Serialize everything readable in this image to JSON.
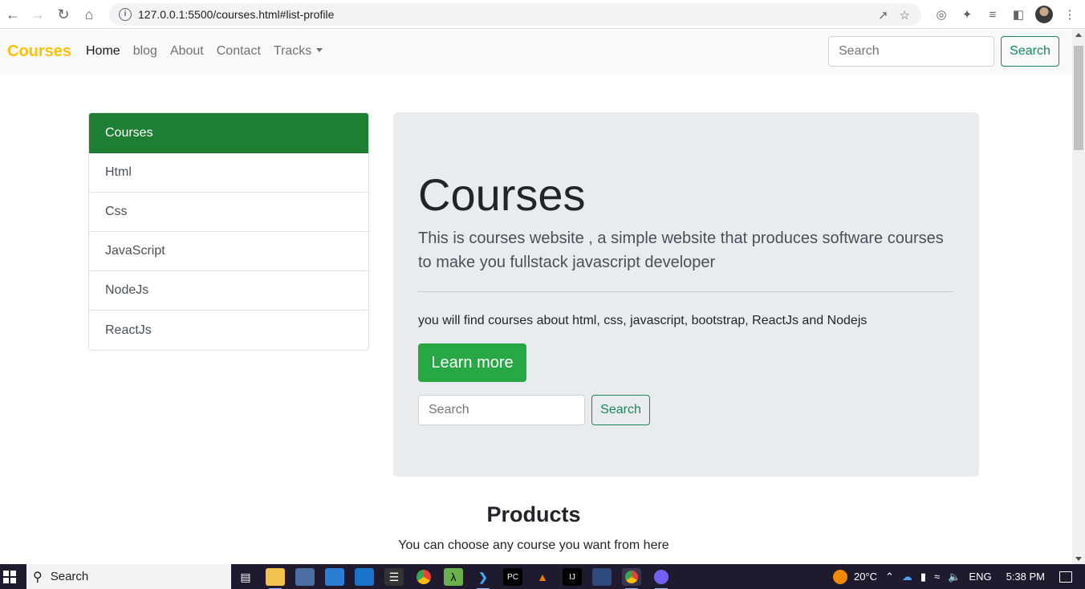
{
  "browser": {
    "url": "127.0.0.1:5500/courses.html#list-profile"
  },
  "navbar": {
    "brand": "Courses",
    "links": [
      {
        "label": "Home",
        "active": true
      },
      {
        "label": "blog",
        "active": false
      },
      {
        "label": "About",
        "active": false
      },
      {
        "label": "Contact",
        "active": false
      },
      {
        "label": "Tracks",
        "active": false,
        "dropdown": true
      }
    ],
    "search_placeholder": "Search",
    "search_button": "Search"
  },
  "list_group": {
    "items": [
      {
        "label": "Courses",
        "active": true
      },
      {
        "label": "Html",
        "active": false
      },
      {
        "label": "Css",
        "active": false
      },
      {
        "label": "JavaScript",
        "active": false
      },
      {
        "label": "NodeJs",
        "active": false
      },
      {
        "label": "ReactJs",
        "active": false
      }
    ]
  },
  "jumbotron": {
    "title": "Courses",
    "lead": "This is courses website , a simple website that produces software courses to make you fullstack javascript developer",
    "text": "you will find courses about html, css, javascript, bootstrap, ReactJs and Nodejs",
    "button": "Learn more",
    "search_placeholder": "Search",
    "search_button": "Search"
  },
  "products": {
    "title": "Products",
    "subtitle": "You can choose any course you want from here"
  },
  "taskbar": {
    "search_label": "Search",
    "temperature": "20°C",
    "language": "ENG",
    "time": "5:38 PM"
  },
  "colors": {
    "brand": "#ffc107",
    "active_list": "#1e7e34",
    "success": "#28a745",
    "outline_success": "#198754",
    "jumbotron_bg": "#e9ecef"
  }
}
